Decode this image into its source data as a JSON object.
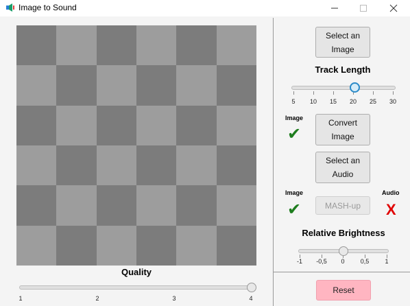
{
  "window": {
    "title": "Image to Sound"
  },
  "colors": {
    "check": "#1e7d1e",
    "cross": "#e00000",
    "reset_button": "#ffb5c1",
    "slider_accent": "#2a8ac8"
  },
  "icons": {
    "app": "speaker-icon",
    "minimize": "minimize-icon",
    "maximize": "maximize-icon",
    "close": "close-icon",
    "check": "checkmark-icon",
    "cross": "cross-icon"
  },
  "left_panel": {
    "quality_label": "Quality",
    "quality_slider": {
      "value": 4,
      "ticks": [
        "1",
        "2",
        "3",
        "4"
      ]
    }
  },
  "right_panel": {
    "select_image_button": [
      "Select an",
      "Image"
    ],
    "track_length_label": "Track Length",
    "track_length_slider": {
      "value": 20,
      "ticks": [
        "5",
        "10",
        "15",
        "20",
        "25",
        "30"
      ]
    },
    "image_status_label": "Image",
    "image_status_mark": "✔",
    "convert_image_button": [
      "Convert",
      "Image"
    ],
    "select_audio_button": [
      "Select an",
      "Audio"
    ],
    "image_label_2": "Image",
    "image_mark_2": "✔",
    "audio_label": "Audio",
    "audio_mark": "X",
    "mashup_button": "MASH-up",
    "relative_brightness_label": "Relative Brightness",
    "brightness_slider": {
      "value": 0,
      "ticks": [
        "-1",
        "-0,5",
        "0",
        "0,5",
        "1"
      ]
    },
    "reset_button": "Reset"
  }
}
